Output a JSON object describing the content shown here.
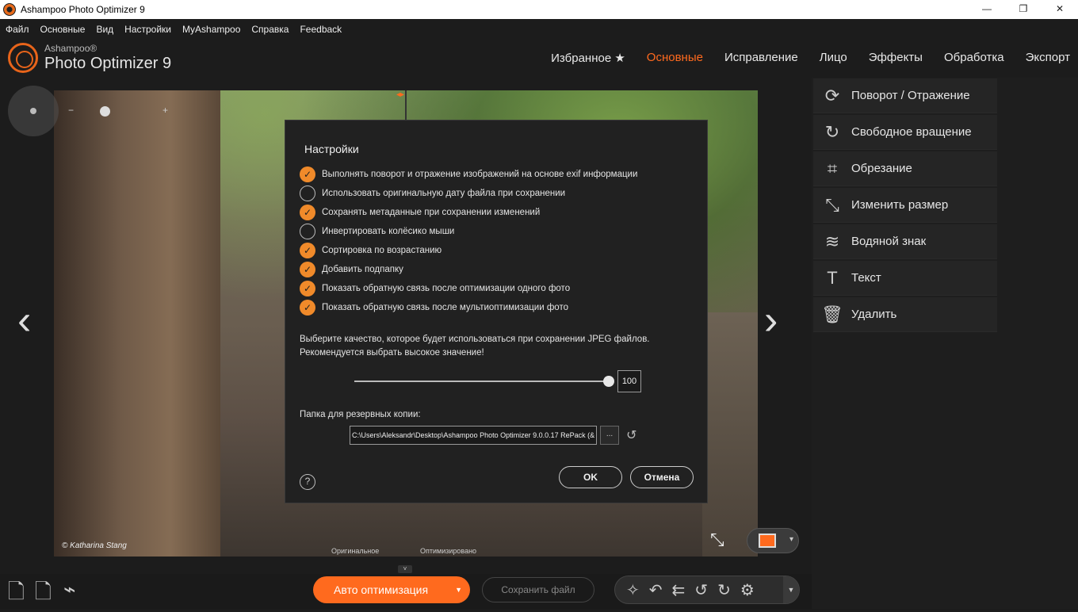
{
  "window": {
    "title": "Ashampoo Photo Optimizer 9",
    "min": "—",
    "max": "❐",
    "close": "✕"
  },
  "menu": [
    "Файл",
    "Основные",
    "Вид",
    "Настройки",
    "MyAshampoo",
    "Справка",
    "Feedback"
  ],
  "logo": {
    "brand": "Ashampoo®",
    "product": "Photo Optimizer 9"
  },
  "topnav": [
    {
      "label": "Избранное ★",
      "active": false
    },
    {
      "label": "Основные",
      "active": true
    },
    {
      "label": "Исправление",
      "active": false
    },
    {
      "label": "Лицо",
      "active": false
    },
    {
      "label": "Эффекты",
      "active": false
    },
    {
      "label": "Обработка",
      "active": false
    },
    {
      "label": "Экспорт",
      "active": false
    }
  ],
  "viewer": {
    "credit": "© Katharina Stang",
    "label_original": "Оригинальное",
    "label_optimized": "Оптимизировано",
    "zoom_minus": "−",
    "zoom_plus": "+",
    "prev": "‹",
    "next": "›"
  },
  "side": [
    {
      "icon": "rotate-flip-icon",
      "glyph": "⟳",
      "label": "Поворот / Отражение"
    },
    {
      "icon": "free-rotate-icon",
      "glyph": "↻",
      "label": "Свободное вращение"
    },
    {
      "icon": "crop-icon",
      "glyph": "⌗",
      "label": "Обрезание"
    },
    {
      "icon": "resize-icon",
      "glyph": "⤡",
      "label": "Изменить размер"
    },
    {
      "icon": "watermark-icon",
      "glyph": "≋",
      "label": "Водяной знак"
    },
    {
      "icon": "text-icon",
      "glyph": "T",
      "label": "Текст"
    },
    {
      "icon": "trash-icon",
      "glyph": "🗑",
      "label": "Удалить"
    }
  ],
  "bottom": {
    "auto_label": "Авто оптимизация",
    "save_label": "Сохранить файл"
  },
  "dialog": {
    "title": "Настройки",
    "options": [
      {
        "label": "Выполнять поворот и отражение изображений на основе exif информации",
        "checked": true
      },
      {
        "label": "Использовать оригинальную дату файла при сохранении",
        "checked": false
      },
      {
        "label": "Сохранять метаданные при сохранении изменений",
        "checked": true
      },
      {
        "label": "Инвертировать колёсико мыши",
        "checked": false
      },
      {
        "label": "Сортировка по возрастанию",
        "checked": true
      },
      {
        "label": "Добавить подпапку",
        "checked": true
      },
      {
        "label": "Показать обратную связь после оптимизации одного фото",
        "checked": true
      },
      {
        "label": "Показать обратную связь после мультиоптимизации фото",
        "checked": true
      }
    ],
    "quality_text": "Выберите качество, которое будет использоваться при сохранении JPEG файлов. Рекомендуется выбрать высокое значение!",
    "quality_value": "100",
    "backup_label": "Папка для резервных копии:",
    "backup_path": "C:\\Users\\Aleksandr\\Desktop\\Ashampoo Photo Optimizer 9.0.0.17 RePack (&",
    "browse": "...",
    "help": "?",
    "ok": "OK",
    "cancel": "Отмена"
  }
}
